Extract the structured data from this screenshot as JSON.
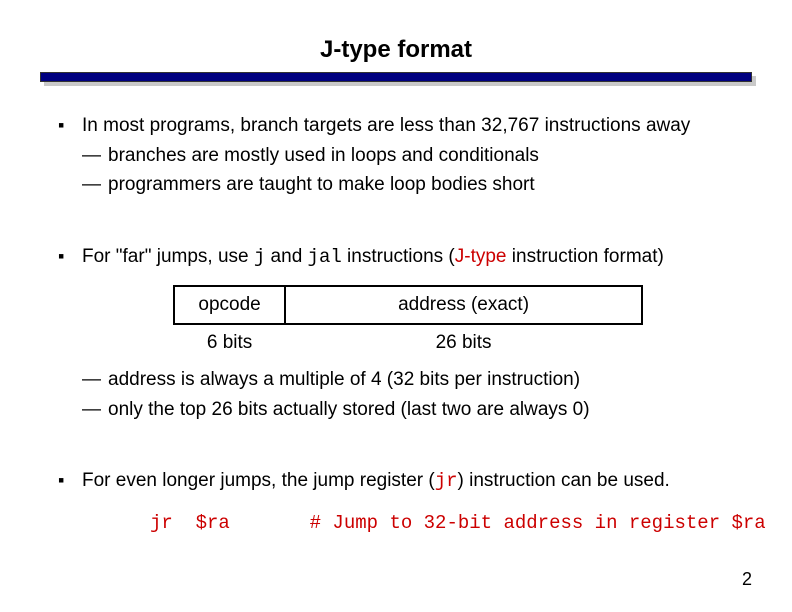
{
  "title": "J-type format",
  "bullets": {
    "b1_text": "In most programs, branch targets are less than 32,767 instructions away",
    "b1_sub1": "branches are mostly used in loops and conditionals",
    "b1_sub2": "programmers are taught to make loop bodies short",
    "b2_pre": "For \"far\" jumps, use ",
    "b2_code1": "j",
    "b2_mid": " and ",
    "b2_code2": "jal",
    "b2_post1": " instructions (",
    "b2_jtype": "J-type",
    "b2_post2": " instruction format)",
    "table_opcode": "opcode",
    "table_addr": "address (exact)",
    "table_opbits": "6 bits",
    "table_addrbits": "26 bits",
    "b2_sub1": "address is always a multiple of 4  (32 bits per instruction)",
    "b2_sub2": "only the top 26 bits actually stored  (last two are always 0)",
    "b3_pre": "For even longer jumps, the jump register (",
    "b3_jr": "jr",
    "b3_post": ") instruction can be used.",
    "jr_line": "jr  $ra       # Jump to 32-bit address in register $ra"
  },
  "page_number": "2"
}
